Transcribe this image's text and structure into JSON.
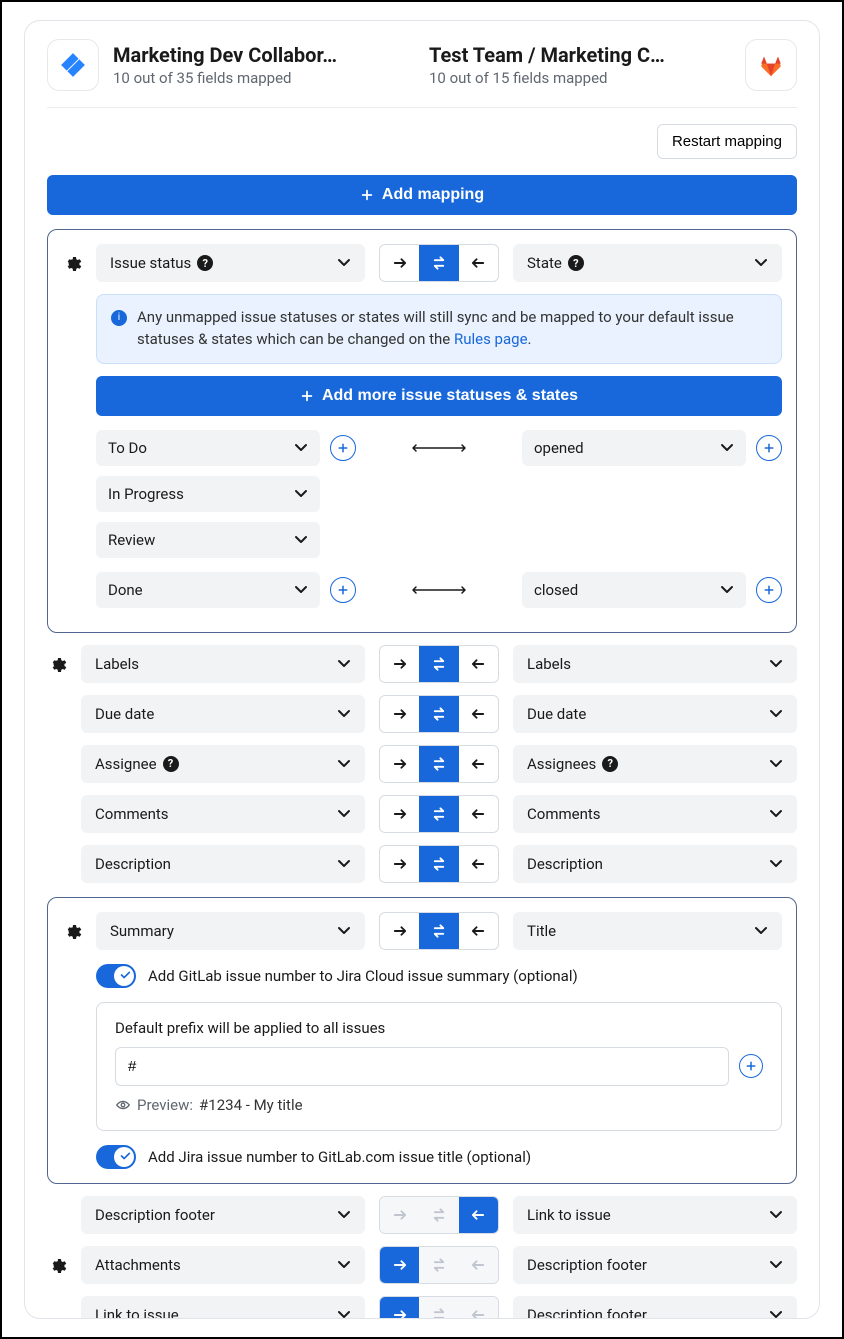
{
  "header": {
    "left": {
      "title": "Marketing Dev Collabor…",
      "sub": "10 out of 35 fields mapped"
    },
    "right": {
      "title": "Test Team / Marketing C…",
      "sub": "10 out of 15 fields mapped"
    }
  },
  "restart_label": "Restart mapping",
  "add_mapping_label": "Add mapping",
  "issue_status_panel": {
    "left_field": "Issue status",
    "right_field": "State",
    "info_text_1": "Any unmapped issue statuses or states will still sync and be mapped to your default issue statuses & states which can be changed on the ",
    "info_link": "Rules page",
    "info_text_2": ".",
    "add_more_label": "Add more issue statuses & states",
    "group1": {
      "left": [
        "To Do",
        "In Progress",
        "Review"
      ],
      "right": "opened"
    },
    "group2": {
      "left": "Done",
      "right": "closed"
    }
  },
  "simple_rows": [
    {
      "left": "Labels",
      "right": "Labels",
      "left_q": false,
      "right_q": false,
      "gear": true
    },
    {
      "left": "Due date",
      "right": "Due date",
      "left_q": false,
      "right_q": false,
      "gear": false
    },
    {
      "left": "Assignee",
      "right": "Assignees",
      "left_q": true,
      "right_q": true,
      "gear": false
    },
    {
      "left": "Comments",
      "right": "Comments",
      "left_q": false,
      "right_q": false,
      "gear": false
    },
    {
      "left": "Description",
      "right": "Description",
      "left_q": false,
      "right_q": false,
      "gear": false
    }
  ],
  "summary_panel": {
    "left_field": "Summary",
    "right_field": "Title",
    "toggle1": "Add GitLab issue number to Jira Cloud issue summary (optional)",
    "prefix_heading": "Default prefix will be applied to all issues",
    "prefix_value": "#",
    "preview_label": "Preview:",
    "preview_value": "#1234 - My title",
    "toggle2": "Add Jira issue number to GitLab.com issue title (optional)"
  },
  "bottom_rows": [
    {
      "left": "Description footer",
      "right": "Link to issue",
      "dir": "left",
      "gear": false
    },
    {
      "left": "Attachments",
      "right": "Description footer",
      "dir": "right",
      "gear": true
    },
    {
      "left": "Link to issue",
      "right": "Description footer",
      "dir": "right",
      "gear": false
    }
  ]
}
